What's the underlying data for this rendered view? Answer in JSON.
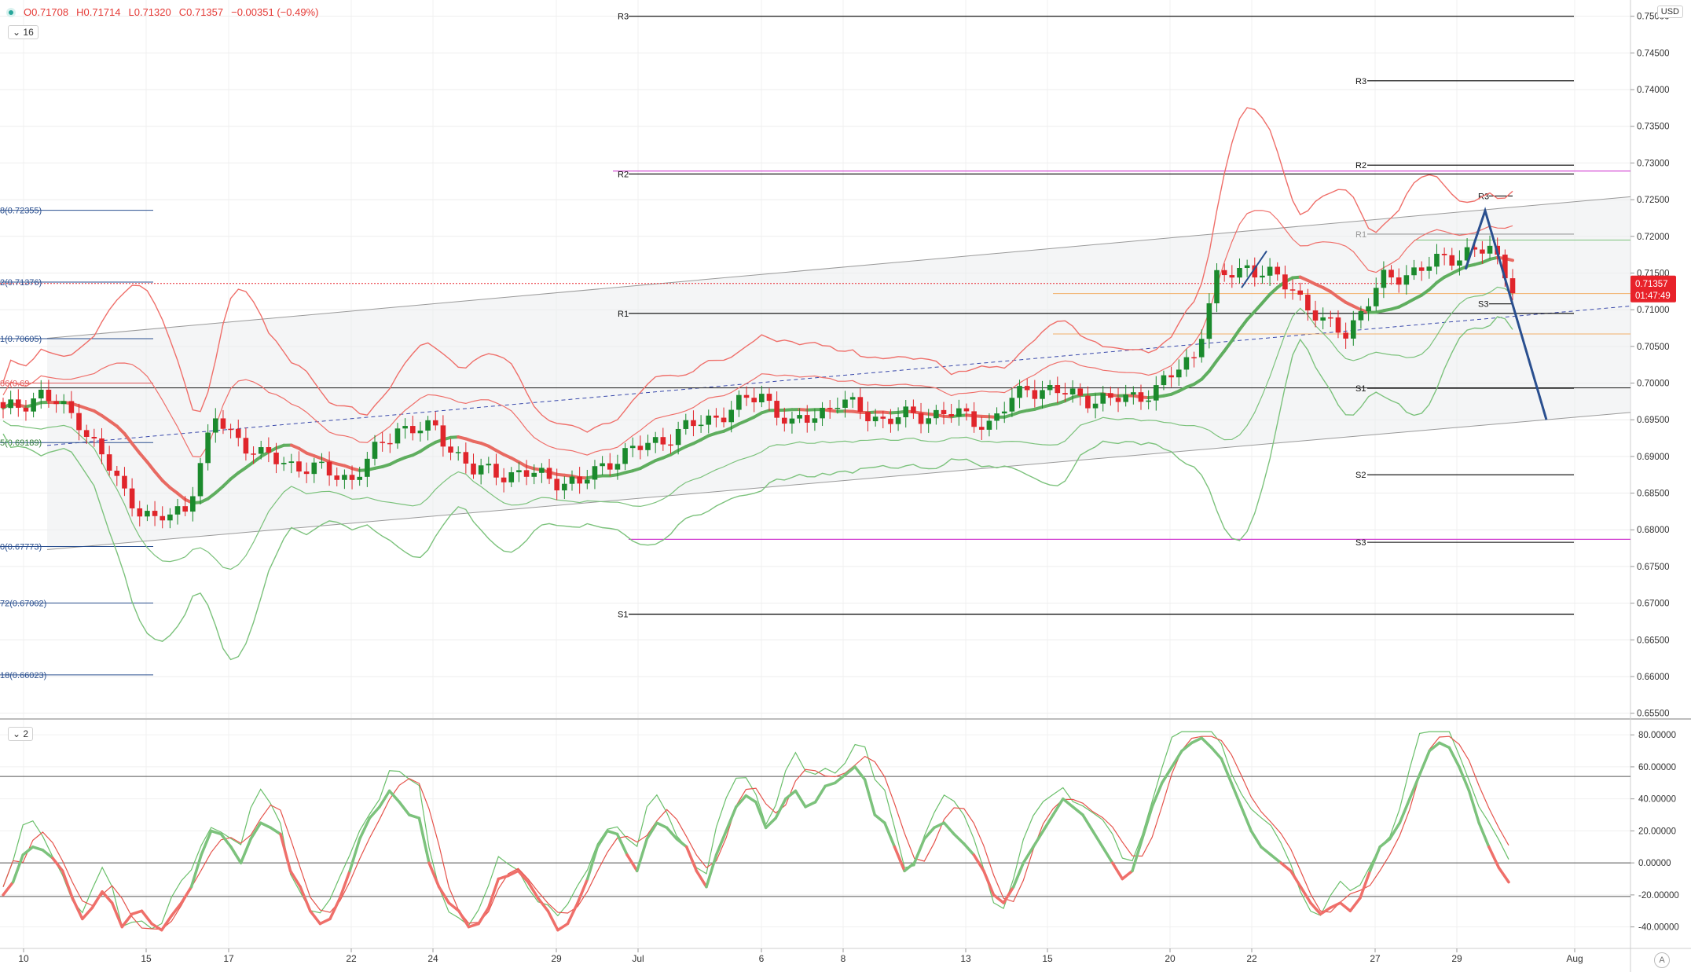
{
  "legend": {
    "open": "O0.71708",
    "high": "H0.71714",
    "low": "L0.71320",
    "close": "C0.71357",
    "change": "−0.00351 (−0.49%)"
  },
  "pane_tags": {
    "main": "16",
    "oscillator": "2"
  },
  "currency": "USD",
  "scale_mode": "A",
  "colors": {
    "bull": "#1b8a2d",
    "bear": "#e0252b",
    "band_red": "#ef6f6a",
    "band_green": "#7cc27c",
    "channel": "#9a9a9a",
    "fib": "#2a4f8f",
    "pivot": "#000000",
    "magenta": "#d13fd1",
    "orange": "#f2b06a",
    "last_price": "#e8222a"
  },
  "chart_data": {
    "type": "candlestick",
    "x_labels": [
      "10",
      "15",
      "17",
      "22",
      "24",
      "29",
      "Jul",
      "6",
      "8",
      "13",
      "15",
      "20",
      "22",
      "27",
      "29",
      "Aug"
    ],
    "y_ticks": [
      "0.75000",
      "0.74500",
      "0.74000",
      "0.73500",
      "0.73000",
      "0.72500",
      "0.72000",
      "0.71500",
      "0.71000",
      "0.70500",
      "0.70000",
      "0.69500",
      "0.69000",
      "0.68500",
      "0.68000",
      "0.67500",
      "0.67000",
      "0.66500",
      "0.66000",
      "0.65500"
    ],
    "ylim": [
      0.654,
      0.752
    ],
    "last_price": {
      "value": 0.71357,
      "label": "0.71357",
      "countdown": "01:47:49"
    },
    "fib_levels": [
      {
        "label": "8(0.72355)",
        "value": 0.72355
      },
      {
        "label": "2(0.71376)",
        "value": 0.71376
      },
      {
        "label": "1(0.70605)",
        "value": 0.70605
      },
      {
        "label": "86(0.69",
        "value": 0.7
      },
      {
        "label": "5(0.69189)",
        "value": 0.69189
      },
      {
        "label": "0(0.67773)",
        "value": 0.67773
      },
      {
        "label": "72(0.67002)",
        "value": 0.67002
      },
      {
        "label": "18(0.66023)",
        "value": 0.66023
      }
    ],
    "pivots_monthly": [
      {
        "label": "R3",
        "value": 0.75
      },
      {
        "label": "R2",
        "value": 0.7285
      },
      {
        "label": "R1",
        "value": 0.7095
      },
      {
        "label": "S1",
        "value": 0.6685
      }
    ],
    "pivots_weekly": [
      {
        "label": "R3",
        "value": 0.7412
      },
      {
        "label": "R2",
        "value": 0.7297
      },
      {
        "label": "R1",
        "value": 0.7203
      },
      {
        "label": "S1",
        "value": 0.6993
      },
      {
        "label": "S2",
        "value": 0.6875
      },
      {
        "label": "S3",
        "value": 0.6783
      }
    ],
    "pivots_daily": [
      {
        "label": "R3",
        "value": 0.7255
      },
      {
        "label": "S3",
        "value": 0.7108
      }
    ],
    "magenta_levels": [
      0.7289,
      0.6787
    ],
    "oscillator": {
      "y_ticks": [
        "80.00000",
        "60.00000",
        "40.00000",
        "20.00000",
        "0.00000",
        "-20.00000",
        "-40.00000"
      ],
      "ylim": [
        -50,
        85
      ],
      "levels": [
        54,
        0,
        -21
      ],
      "main_series": [
        -20,
        -12,
        5,
        10,
        8,
        3,
        -5,
        -22,
        -35,
        -28,
        -18,
        -25,
        -40,
        -32,
        -30,
        -38,
        -42,
        -33,
        -25,
        -15,
        5,
        20,
        18,
        10,
        0,
        15,
        25,
        22,
        18,
        -5,
        -15,
        -30,
        -38,
        -35,
        -22,
        -5,
        15,
        28,
        35,
        45,
        38,
        30,
        28,
        0,
        -15,
        -25,
        -30,
        -40,
        -38,
        -28,
        -10,
        -8,
        -5,
        -12,
        -22,
        -30,
        -42,
        -38,
        -25,
        -10,
        10,
        20,
        18,
        5,
        -5,
        15,
        25,
        22,
        15,
        10,
        -5,
        -15,
        5,
        20,
        35,
        42,
        38,
        22,
        28,
        40,
        45,
        35,
        38,
        48,
        50,
        55,
        60,
        52,
        30,
        25,
        10,
        -5,
        0,
        15,
        22,
        25,
        18,
        12,
        5,
        -5,
        -20,
        -25,
        -15,
        0,
        10,
        20,
        30,
        40,
        35,
        30,
        20,
        10,
        0,
        -10,
        -5,
        15,
        35,
        50,
        60,
        70,
        75,
        78,
        72,
        65,
        50,
        35,
        20,
        10,
        5,
        0,
        -5,
        -15,
        -25,
        -32,
        -28,
        -25,
        -30,
        -22,
        -5,
        10,
        15,
        25,
        40,
        55,
        70,
        75,
        72,
        60,
        45,
        25,
        10,
        -3,
        -12
      ]
    }
  }
}
